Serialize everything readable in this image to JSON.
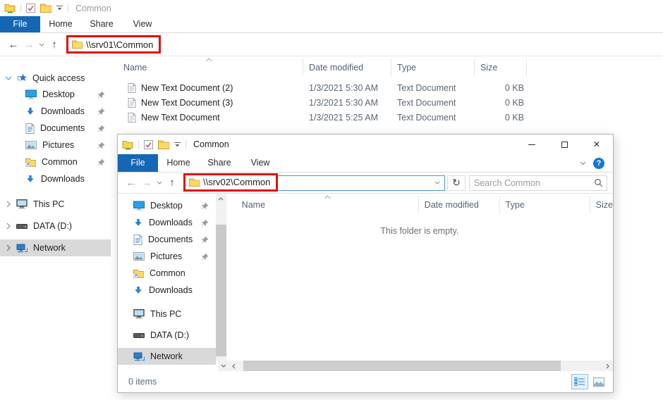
{
  "colors": {
    "accent_blue": "#1467b5",
    "annotation_red": "#dd1111",
    "selection_gray": "#d9d9d9",
    "address_focus_border": "#4f93d2",
    "help_badge_blue": "#1876d2"
  },
  "icons": {
    "back": "←",
    "forward": "→",
    "up": "↑",
    "refresh": "↻",
    "close": "✕",
    "help": "?",
    "minimize": "thin-bar",
    "maximize": "outline-square",
    "search": "magnifier",
    "pin": "pushpin",
    "sort": "chevron-up"
  },
  "w1": {
    "title": "Common",
    "tabs": {
      "file": "File",
      "home": "Home",
      "share": "Share",
      "view": "View"
    },
    "address": "\\\\srv01\\Common",
    "columns": {
      "name": "Name",
      "date": "Date modified",
      "type": "Type",
      "size": "Size"
    },
    "files": [
      {
        "name": "New Text Document (2)",
        "date": "1/3/2021 5:30 AM",
        "type": "Text Document",
        "size": "0 KB"
      },
      {
        "name": "New Text Document (3)",
        "date": "1/3/2021 5:30 AM",
        "type": "Text Document",
        "size": "0 KB"
      },
      {
        "name": "New Text Document",
        "date": "1/3/2021 5:25 AM",
        "type": "Text Document",
        "size": "0 KB"
      }
    ],
    "sidebar": {
      "quick_access": "Quick access",
      "items": [
        {
          "label": "Desktop"
        },
        {
          "label": "Downloads"
        },
        {
          "label": "Documents"
        },
        {
          "label": "Pictures"
        },
        {
          "label": "Common"
        },
        {
          "label": "Downloads"
        }
      ],
      "tree": [
        {
          "label": "This PC"
        },
        {
          "label": "DATA (D:)"
        },
        {
          "label": "Network"
        }
      ]
    }
  },
  "w2": {
    "title": "Common",
    "tabs": {
      "file": "File",
      "home": "Home",
      "share": "Share",
      "view": "View"
    },
    "address": "\\\\srv02\\Common",
    "search_placeholder": "Search Common",
    "columns": {
      "name": "Name",
      "date": "Date modified",
      "type": "Type",
      "size": "Size"
    },
    "empty_message": "This folder is empty.",
    "status": "0 items",
    "sidebar": {
      "items": [
        {
          "label": "Desktop"
        },
        {
          "label": "Downloads"
        },
        {
          "label": "Documents"
        },
        {
          "label": "Pictures"
        },
        {
          "label": "Common"
        },
        {
          "label": "Downloads"
        }
      ],
      "tree": [
        {
          "label": "This PC"
        },
        {
          "label": "DATA (D:)"
        },
        {
          "label": "Network"
        }
      ]
    }
  }
}
